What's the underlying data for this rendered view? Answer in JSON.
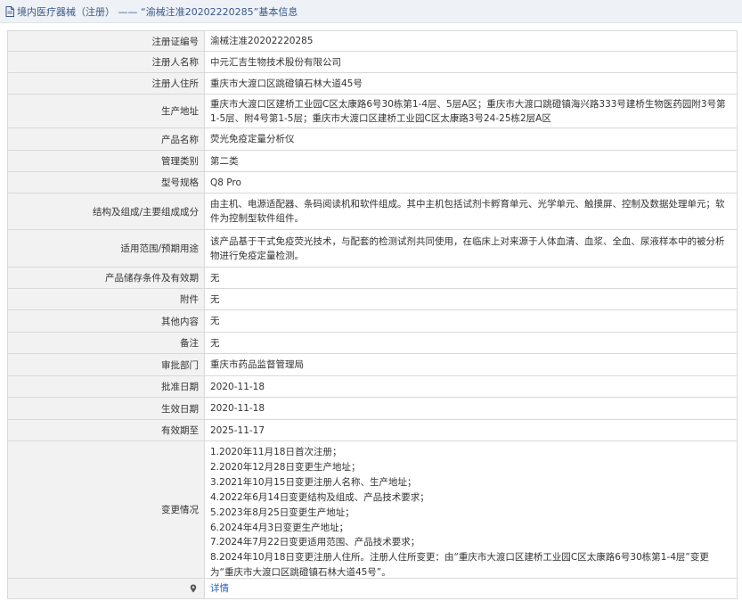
{
  "header": {
    "title": "境内医疗器械（注册） —— “渝械注准20202220285”基本信息"
  },
  "rows": [
    {
      "label": "注册证编号",
      "value": "渝械注准20202220285"
    },
    {
      "label": "注册人名称",
      "value": "中元汇吉生物技术股份有限公司"
    },
    {
      "label": "注册人住所",
      "value": "重庆市大渡口区跳磴镇石林大道45号"
    },
    {
      "label": "生产地址",
      "value": "重庆市大渡口区建桥工业园C区太康路6号30栋第1-4层、5层A区；重庆市大渡口跳磴镇海兴路333号建桥生物医药园附3号第1-5层、附4号第1-5层；重庆市大渡口区建桥工业园C区太康路3号24-25栋2层A区"
    },
    {
      "label": "产品名称",
      "value": "荧光免疫定量分析仪"
    },
    {
      "label": "管理类别",
      "value": "第二类"
    },
    {
      "label": "型号规格",
      "value": "Q8 Pro"
    },
    {
      "label": "结构及组成/主要组成成分",
      "value": "由主机、电源适配器、条码阅读机和软件组成。其中主机包括试剂卡孵育单元、光学单元、触摸屏、控制及数据处理单元；软件为控制型软件组件。"
    },
    {
      "label": "适用范围/预期用途",
      "value": "该产品基于干式免疫荧光技术，与配套的检测试剂共同使用，在临床上对来源于人体血清、血浆、全血、尿液样本中的被分析物进行免疫定量检测。"
    },
    {
      "label": "产品储存条件及有效期",
      "value": "无"
    },
    {
      "label": "附件",
      "value": "无"
    },
    {
      "label": "其他内容",
      "value": "无"
    },
    {
      "label": "备注",
      "value": "无"
    },
    {
      "label": "审批部门",
      "value": "重庆市药品监督管理局"
    },
    {
      "label": "批准日期",
      "value": "2020-11-18"
    },
    {
      "label": "生效日期",
      "value": "2020-11-18"
    },
    {
      "label": "有效期至",
      "value": "2025-11-17"
    }
  ],
  "changes": {
    "label": "变更情况",
    "items": [
      "1.2020年11月18日首次注册；",
      "2.2020年12月28日变更生产地址；",
      "3.2021年10月15日变更注册人名称、生产地址；",
      "4.2022年6月14日变更结构及组成、产品技术要求；",
      "5.2023年8月25日变更生产地址；",
      "6.2024年4月3日变更生产地址；",
      "7.2024年7月22日变更适用范围、产品技术要求；",
      "8.2024年10月18日变更注册人住所。注册人住所变更：由“重庆市大渡口区建桥工业园C区太康路6号30栋第1-4层”变更为“重庆市大渡口区跳磴镇石林大道45号”。"
    ]
  },
  "detail": {
    "label": "详情",
    "icon": "pin-icon"
  }
}
